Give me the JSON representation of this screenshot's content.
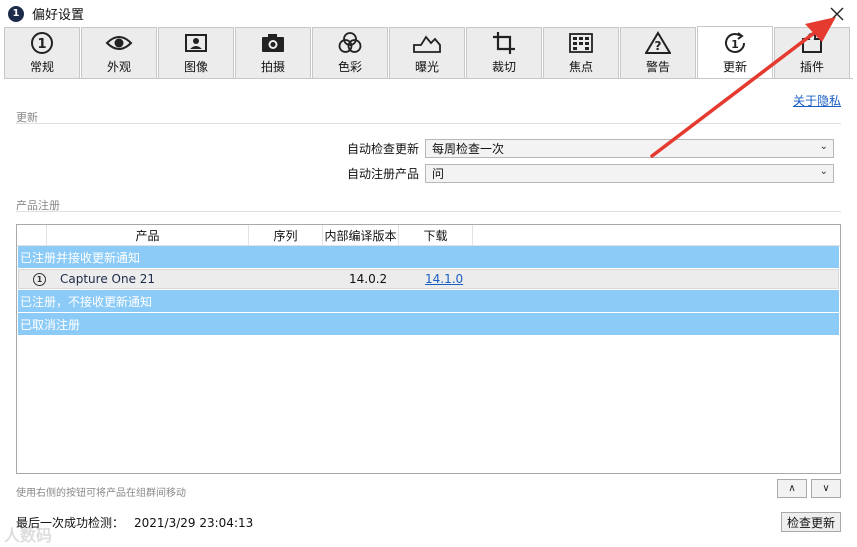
{
  "window": {
    "title": "偏好设置"
  },
  "tabs": [
    {
      "label": "常规",
      "icon": "info-circle-icon"
    },
    {
      "label": "外观",
      "icon": "eye-icon"
    },
    {
      "label": "图像",
      "icon": "image-icon"
    },
    {
      "label": "拍摄",
      "icon": "camera-icon"
    },
    {
      "label": "色彩",
      "icon": "color-circles-icon"
    },
    {
      "label": "曝光",
      "icon": "exposure-icon"
    },
    {
      "label": "裁切",
      "icon": "crop-icon"
    },
    {
      "label": "焦点",
      "icon": "focus-grid-icon"
    },
    {
      "label": "警告",
      "icon": "warning-icon"
    },
    {
      "label": "更新",
      "icon": "update-icon",
      "active": true
    },
    {
      "label": "插件",
      "icon": "puzzle-icon"
    }
  ],
  "privacy_link": "关于隐私",
  "update_section": {
    "title": "更新",
    "auto_check_label": "自动检查更新",
    "auto_check_value": "每周检查一次",
    "auto_register_label": "自动注册产品",
    "auto_register_value": "问"
  },
  "registration_section": {
    "title": "产品注册",
    "columns": [
      "产品",
      "序列",
      "内部编译版本",
      "下载"
    ],
    "group_registered": "已注册并接收更新通知",
    "product": {
      "name": "Capture One 21",
      "serial": "",
      "build": "14.0.2",
      "download": "14.1.0"
    },
    "group_no_notify": "已注册，不接收更新通知",
    "group_unregistered": "已取消注册"
  },
  "hint": "使用右侧的按钮可将产品在组群间移动",
  "move_up": "∧",
  "move_down": "∨",
  "last_check_label": "最后一次成功检测：",
  "last_check_date": "2021/3/29 23:04:13",
  "check_button": "检查更新",
  "watermark": "人数码",
  "colors": {
    "selection": "#8ccbf7",
    "link": "#1a5fc4",
    "arrow": "#e53a2f"
  }
}
